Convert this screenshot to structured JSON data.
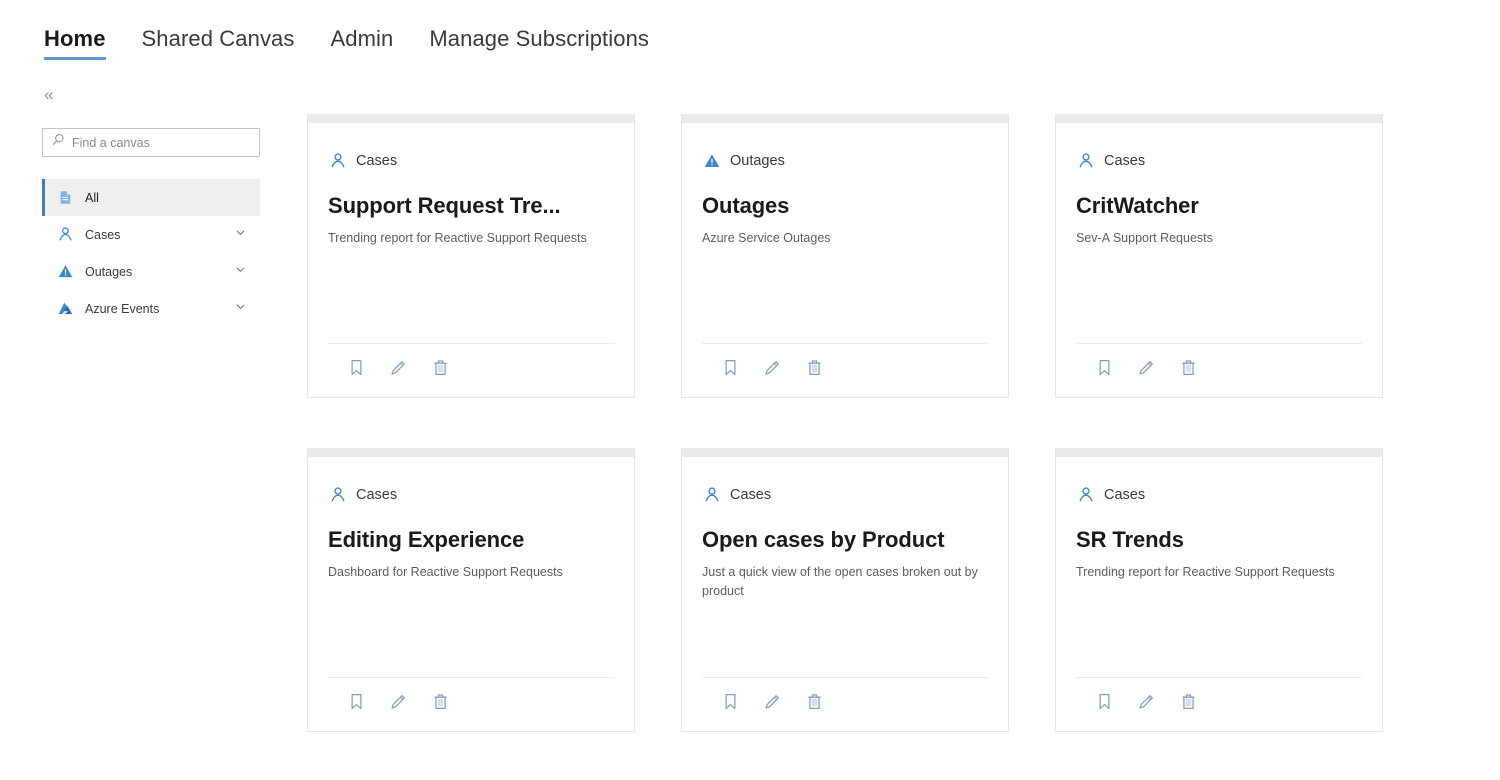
{
  "topnav": {
    "items": [
      {
        "label": "Home",
        "active": true
      },
      {
        "label": "Shared Canvas",
        "active": false
      },
      {
        "label": "Admin",
        "active": false
      },
      {
        "label": "Manage Subscriptions",
        "active": false
      }
    ]
  },
  "collapse": {
    "glyph": "«",
    "icon": "double-chevron-left-icon"
  },
  "sidebar": {
    "search": {
      "placeholder": "Find a canvas",
      "value": "",
      "icon": "search-icon"
    },
    "items": [
      {
        "label": "All",
        "icon": "document-icon",
        "selected": true,
        "expandable": false
      },
      {
        "label": "Cases",
        "icon": "contact-person-icon",
        "selected": false,
        "expandable": true
      },
      {
        "label": "Outages",
        "icon": "warning-triangle-icon",
        "selected": false,
        "expandable": true
      },
      {
        "label": "Azure Events",
        "icon": "azure-logo-icon",
        "selected": false,
        "expandable": true
      }
    ]
  },
  "cards": [
    {
      "category": "Cases",
      "category_icon": "contact-person-icon",
      "title": "Support Request Tre...",
      "description": "Trending report for Reactive Support Requests",
      "actions": [
        {
          "name": "bookmark",
          "icon": "bookmark-icon"
        },
        {
          "name": "edit",
          "icon": "pencil-icon"
        },
        {
          "name": "delete",
          "icon": "trash-icon"
        }
      ]
    },
    {
      "category": "Outages",
      "category_icon": "warning-triangle-icon",
      "title": "Outages",
      "description": "Azure Service Outages",
      "actions": [
        {
          "name": "bookmark",
          "icon": "bookmark-icon"
        },
        {
          "name": "edit",
          "icon": "pencil-icon"
        },
        {
          "name": "delete",
          "icon": "trash-icon"
        }
      ]
    },
    {
      "category": "Cases",
      "category_icon": "contact-person-icon",
      "title": "CritWatcher",
      "description": "Sev-A Support Requests",
      "actions": [
        {
          "name": "bookmark",
          "icon": "bookmark-icon"
        },
        {
          "name": "edit",
          "icon": "pencil-icon"
        },
        {
          "name": "delete",
          "icon": "trash-icon"
        }
      ]
    },
    {
      "category": "Cases",
      "category_icon": "contact-person-icon",
      "title": "Editing Experience",
      "description": "Dashboard for Reactive Support Requests",
      "actions": [
        {
          "name": "bookmark",
          "icon": "bookmark-icon"
        },
        {
          "name": "edit",
          "icon": "pencil-icon"
        },
        {
          "name": "delete",
          "icon": "trash-icon"
        }
      ]
    },
    {
      "category": "Cases",
      "category_icon": "contact-person-icon",
      "title": "Open cases by Product",
      "description": "Just a quick view of the open cases broken out by product",
      "actions": [
        {
          "name": "bookmark",
          "icon": "bookmark-icon"
        },
        {
          "name": "edit",
          "icon": "pencil-icon"
        },
        {
          "name": "delete",
          "icon": "trash-icon"
        }
      ]
    },
    {
      "category": "Cases",
      "category_icon": "contact-person-icon",
      "title": "SR Trends",
      "description": "Trending report for Reactive Support Requests",
      "actions": [
        {
          "name": "bookmark",
          "icon": "bookmark-icon"
        },
        {
          "name": "edit",
          "icon": "pencil-icon"
        },
        {
          "name": "delete",
          "icon": "trash-icon"
        }
      ]
    }
  ],
  "colors": {
    "accent": "#5b9bd5",
    "icon_blue": "#3a87d4",
    "selected_bar": "#3a7ebf",
    "action_icon": "#7f9dc2",
    "title": "#1b1a19",
    "description": "#605e5c"
  }
}
